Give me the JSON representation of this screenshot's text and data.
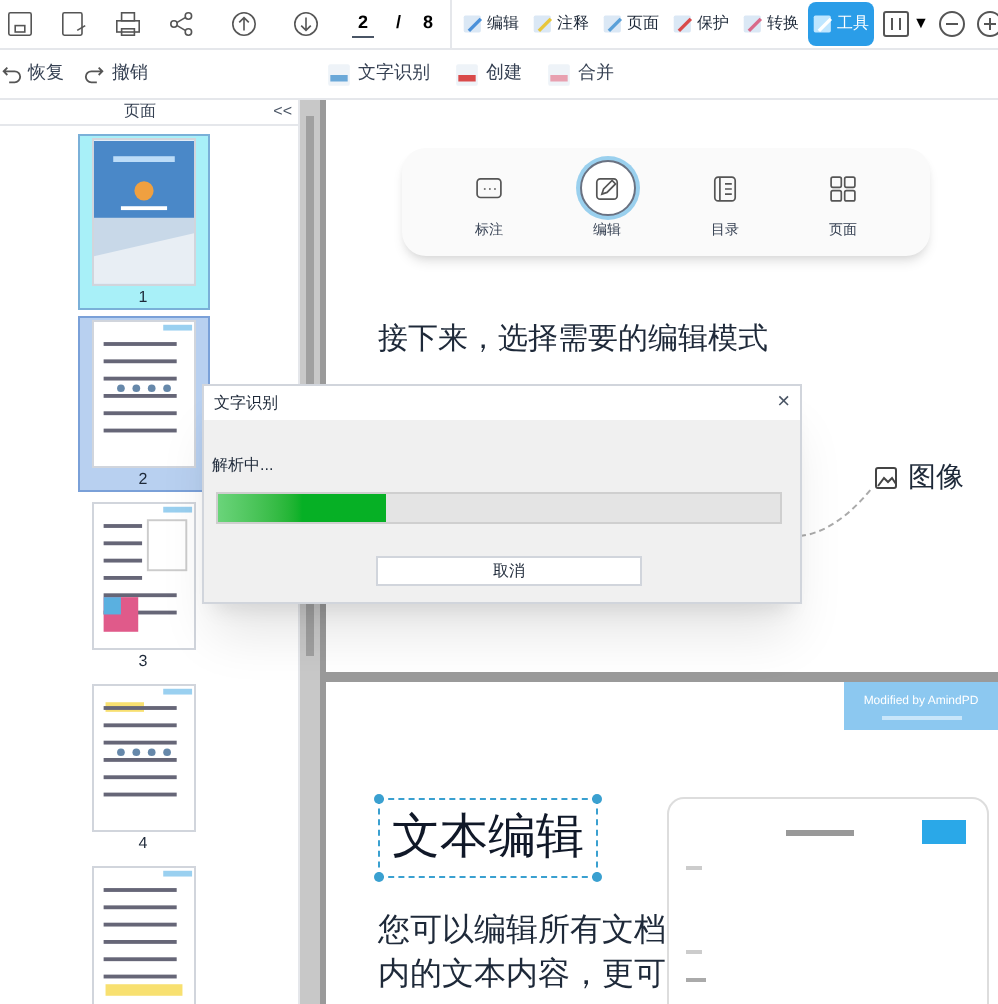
{
  "toolbar": {
    "page_input": "2",
    "page_separator": "/",
    "page_total": "8",
    "tabs": [
      {
        "label": "编辑",
        "selected": false
      },
      {
        "label": "注释",
        "selected": false
      },
      {
        "label": "页面",
        "selected": false
      },
      {
        "label": "保护",
        "selected": false
      },
      {
        "label": "转换",
        "selected": false
      },
      {
        "label": "工具",
        "selected": true
      }
    ],
    "zoom_caret": "▼"
  },
  "subtoolbar": {
    "history": [
      {
        "label": "恢复"
      },
      {
        "label": "撤销"
      }
    ],
    "tools": [
      {
        "label": "文字识别"
      },
      {
        "label": "创建"
      },
      {
        "label": "合并"
      }
    ]
  },
  "sidebar": {
    "title": "页面",
    "collapse": "<<",
    "thumbnails": [
      {
        "number": "1",
        "selected": false,
        "hovered": true
      },
      {
        "number": "2",
        "selected": true,
        "hovered": false
      },
      {
        "number": "3",
        "selected": false,
        "hovered": false
      },
      {
        "number": "4",
        "selected": false,
        "hovered": false
      },
      {
        "selected": false,
        "hovered": false
      }
    ]
  },
  "page_1": {
    "mode_bar": [
      {
        "label": "标注",
        "selected": false
      },
      {
        "label": "编辑",
        "selected": true
      },
      {
        "label": "目录",
        "selected": false
      },
      {
        "label": "页面",
        "selected": false
      }
    ],
    "heading": "接下来，选择需要的编辑模式",
    "image_label": "图像"
  },
  "page_2": {
    "badge": "Modified by AmindPD",
    "heading": "文本编辑",
    "paragraph": "您可以编辑所有文档内的文本内容，更可"
  },
  "dialog": {
    "title": "文字识别",
    "close": "×",
    "status": "解析中...",
    "progress": {
      "level": 0.3
    },
    "cancel": "取消"
  }
}
